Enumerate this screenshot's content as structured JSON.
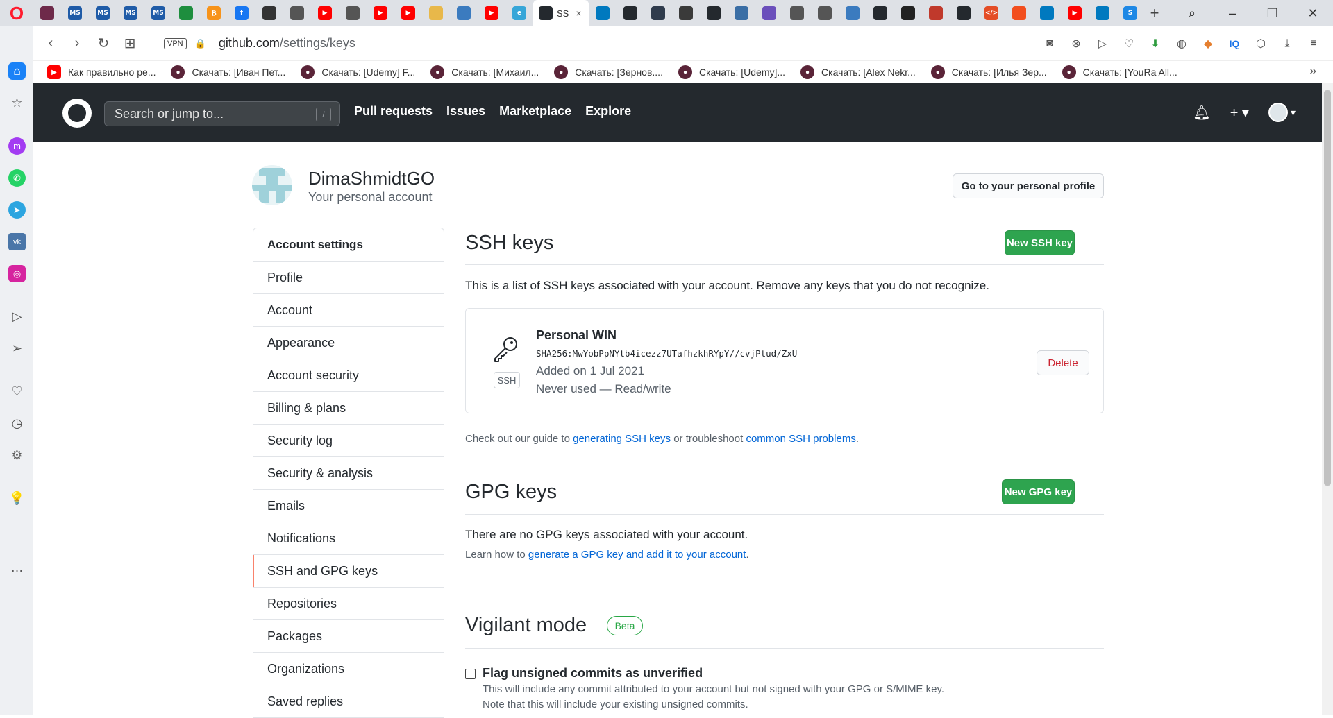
{
  "browser": {
    "active_tab_title": "SS",
    "tab_close": "×",
    "tab_new": "+",
    "url_host": "github.com",
    "url_path": "/settings/keys",
    "vpn_label": "VPN",
    "tabs": [
      {
        "icon": "github-icon",
        "color": "#6e2a4a",
        "text": ""
      },
      {
        "icon": "ms-icon",
        "color": "#1f5ba7",
        "text": "MS"
      },
      {
        "icon": "ms-icon",
        "color": "#1f5ba7",
        "text": "MS"
      },
      {
        "icon": "ms-icon",
        "color": "#1f5ba7",
        "text": "MS"
      },
      {
        "icon": "ms-icon",
        "color": "#1f5ba7",
        "text": "MS"
      },
      {
        "icon": "green-circle-icon",
        "color": "#1e8e3e",
        "text": ""
      },
      {
        "icon": "bitcoin-icon",
        "color": "#f7931a",
        "text": "₿"
      },
      {
        "icon": "facebook-icon",
        "color": "#1877f2",
        "text": "f"
      },
      {
        "icon": "contact-icon",
        "color": "#333333",
        "text": ""
      },
      {
        "icon": "document-icon",
        "color": "#555555",
        "text": ""
      },
      {
        "icon": "youtube-icon",
        "color": "#ff0000",
        "text": "▶"
      },
      {
        "icon": "document-icon",
        "color": "#555555",
        "text": ""
      },
      {
        "icon": "youtube-icon",
        "color": "#ff0000",
        "text": "▶"
      },
      {
        "icon": "youtube-icon",
        "color": "#ff0000",
        "text": "▶"
      },
      {
        "icon": "person-icon",
        "color": "#e8b84a",
        "text": ""
      },
      {
        "icon": "extension-icon",
        "color": "#3b7bbf",
        "text": ""
      },
      {
        "icon": "youtube-icon",
        "color": "#ff0000",
        "text": "▶"
      },
      {
        "icon": "e-icon",
        "color": "#37a6d8",
        "text": "e"
      }
    ],
    "tabs_after": [
      {
        "icon": "trello-icon",
        "color": "#0079bf",
        "text": ""
      },
      {
        "icon": "github-icon",
        "color": "#24292e",
        "text": ""
      },
      {
        "icon": "layers-icon",
        "color": "#2f3b4c",
        "text": ""
      },
      {
        "icon": "dots-icon",
        "color": "#3a3a3a",
        "text": ""
      },
      {
        "icon": "github-icon",
        "color": "#24292e",
        "text": ""
      },
      {
        "icon": "chart-icon",
        "color": "#3a6ea5",
        "text": ""
      },
      {
        "icon": "app-icon",
        "color": "#6b4fbb",
        "text": ""
      },
      {
        "icon": "document-icon",
        "color": "#555555",
        "text": ""
      },
      {
        "icon": "document-icon",
        "color": "#555555",
        "text": ""
      },
      {
        "icon": "extension-icon",
        "color": "#3b7bbf",
        "text": ""
      },
      {
        "icon": "github-icon",
        "color": "#24292e",
        "text": ""
      },
      {
        "icon": "code-icon",
        "color": "#222222",
        "text": ""
      },
      {
        "icon": "app-icon",
        "color": "#c0392b",
        "text": ""
      },
      {
        "icon": "github-icon",
        "color": "#24292e",
        "text": ""
      },
      {
        "icon": "code-icon",
        "color": "#e44d26",
        "text": "</>"
      },
      {
        "icon": "figma-icon",
        "color": "#f24e1e",
        "text": ""
      },
      {
        "icon": "trello-icon",
        "color": "#0079bf",
        "text": ""
      },
      {
        "icon": "youtube-icon",
        "color": "#ff0000",
        "text": "▶"
      },
      {
        "icon": "trello-icon",
        "color": "#0079bf",
        "text": ""
      },
      {
        "icon": "s-icon",
        "color": "#1e88e5",
        "text": "S"
      }
    ],
    "bookmarks": [
      {
        "label": "Как правильно ре...",
        "icon": "youtube-icon",
        "color": "#ff0000"
      },
      {
        "label": "Скачать: [Иван Пет...",
        "icon": "bookmark-icon",
        "color": "#5a2438"
      },
      {
        "label": "Скачать: [Udemy] F...",
        "icon": "bookmark-icon",
        "color": "#5a2438"
      },
      {
        "label": "Скачать: [Михаил...",
        "icon": "bookmark-icon",
        "color": "#5a2438"
      },
      {
        "label": "Скачать: [Зернов....",
        "icon": "bookmark-icon",
        "color": "#5a2438"
      },
      {
        "label": "Скачать: [Udemy]...",
        "icon": "bookmark-icon",
        "color": "#5a2438"
      },
      {
        "label": "Скачать: [Alex Nekr...",
        "icon": "bookmark-icon",
        "color": "#5a2438"
      },
      {
        "label": "Скачать: [Илья Зер...",
        "icon": "bookmark-icon",
        "color": "#5a2438"
      },
      {
        "label": "Скачать: [YouRa All...",
        "icon": "bookmark-icon",
        "color": "#5a2438"
      }
    ],
    "bookmarks_more": "»"
  },
  "github": {
    "search_placeholder": "Search or jump to...",
    "search_key": "/",
    "nav": [
      "Pull requests",
      "Issues",
      "Marketplace",
      "Explore"
    ],
    "plus": "+ ▾",
    "avatar_caret": "▾"
  },
  "user": {
    "name": "DimaShmidtGO",
    "subtitle": "Your personal account",
    "profile_button": "Go to your personal profile"
  },
  "menu": {
    "heading": "Account settings",
    "items": [
      "Profile",
      "Account",
      "Appearance",
      "Account security",
      "Billing & plans",
      "Security log",
      "Security & analysis",
      "Emails",
      "Notifications",
      "SSH and GPG keys",
      "Repositories",
      "Packages",
      "Organizations",
      "Saved replies"
    ],
    "selected_index": 9
  },
  "ssh": {
    "title": "SSH keys",
    "new_button": "New SSH key",
    "description": "This is a list of SSH keys associated with your account. Remove any keys that you do not recognize.",
    "key": {
      "title": "Personal WIN",
      "fingerprint": "SHA256:MwYobPpNYtb4icezz7UTafhzkhRYpY//cvjPtud/ZxU",
      "added": "Added on 1 Jul 2021",
      "usage": "Never used — Read/write",
      "badge": "SSH",
      "delete": "Delete"
    },
    "guide_prefix": "Check out our guide to ",
    "guide_link1": "generating SSH keys",
    "guide_middle": " or troubleshoot ",
    "guide_link2": "common SSH problems",
    "guide_suffix": "."
  },
  "gpg": {
    "title": "GPG keys",
    "new_button": "New GPG key",
    "empty": "There are no GPG keys associated with your account.",
    "learn_prefix": "Learn how to ",
    "learn_link": "generate a GPG key and add it to your account",
    "learn_suffix": "."
  },
  "vigilant": {
    "title": "Vigilant mode",
    "badge": "Beta",
    "checkbox_label": "Flag unsigned commits as unverified",
    "checked": false,
    "note1": "This will include any commit attributed to your account but not signed with your GPG or S/MIME key.",
    "note2": "Note that this will include your existing unsigned commits."
  },
  "colors": {
    "primary_button": "#2ea44f",
    "danger_text": "#cb2431",
    "link": "#0366d6",
    "header_bg": "#24292e",
    "selected_menu_accent": "#f9826c"
  }
}
